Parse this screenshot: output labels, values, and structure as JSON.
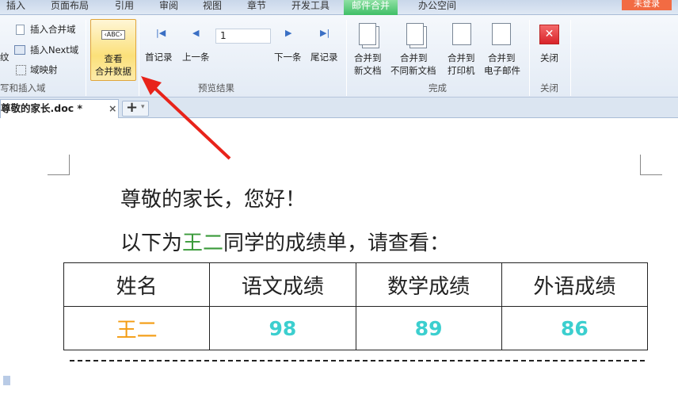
{
  "menu": {
    "items": [
      "插入",
      "页面布局",
      "引用",
      "审阅",
      "视图",
      "章节",
      "开发工具",
      "邮件合并",
      "办公空间"
    ],
    "login": "未登录"
  },
  "ribbon": {
    "insert_merge_field": "插入合并域",
    "insert_next": "插入Next域",
    "field_map": "域映射",
    "left_cut": "纹",
    "group_write": "写和插入域",
    "view_merge_1": "查看",
    "view_merge_2": "合并数据",
    "view_icon_text": "‹ABC›",
    "first": "首记录",
    "prev": "上一条",
    "record_value": "1",
    "next": "下一条",
    "last": "尾记录",
    "group_preview": "预览结果",
    "merge_new_1": "合并到",
    "merge_new_2": "新文档",
    "merge_diff_1": "合并到",
    "merge_diff_2": "不同新文档",
    "merge_print_1": "合并到",
    "merge_print_2": "打印机",
    "merge_mail_1": "合并到",
    "merge_mail_2": "电子邮件",
    "group_finish": "完成",
    "close": "关闭",
    "group_close": "关闭"
  },
  "doctab": {
    "name": "尊敬的家长.doc *",
    "close": "×",
    "add": "+",
    "dropdown": "▾"
  },
  "document": {
    "greeting": "尊敬的家长，您好！",
    "intro_pre": "以下为",
    "student": "王二",
    "intro_post": "同学的成绩单，请查看：",
    "table": {
      "headers": [
        "姓名",
        "语文成绩",
        "数学成绩",
        "外语成绩"
      ],
      "row": [
        "王二",
        "98",
        "89",
        "86"
      ]
    }
  },
  "colors": {
    "accent": "#3fbf66",
    "highlight": "#fbe07a",
    "score": "#3ccfcf",
    "name": "#f39c12",
    "arrow": "#e8231a"
  }
}
